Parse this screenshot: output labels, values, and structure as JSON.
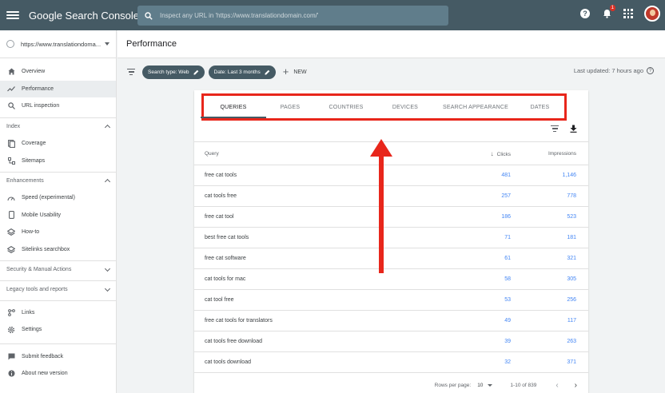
{
  "app": {
    "title": "Google Search Console"
  },
  "search": {
    "placeholder": "Inspect any URL in 'https://www.translationdomain.com/'"
  },
  "header": {
    "notifications_count": "1"
  },
  "property": {
    "label": "https://www.translationdoma..."
  },
  "sidebar": {
    "main_items": [
      {
        "label": "Overview",
        "icon": "home-icon"
      },
      {
        "label": "Performance",
        "icon": "trend-icon",
        "active": true
      },
      {
        "label": "URL inspection",
        "icon": "search-icon"
      }
    ],
    "index_section": "Index",
    "index_items": [
      {
        "label": "Coverage",
        "icon": "coverage-icon"
      },
      {
        "label": "Sitemaps",
        "icon": "sitemap-icon"
      }
    ],
    "enhancements_section": "Enhancements",
    "enhancement_items": [
      {
        "label": "Speed (experimental)",
        "icon": "speed-icon"
      },
      {
        "label": "Mobile Usability",
        "icon": "mobile-icon"
      },
      {
        "label": "How-to",
        "icon": "layers-icon"
      },
      {
        "label": "Sitelinks searchbox",
        "icon": "layers-icon"
      }
    ],
    "security_section": "Security & Manual Actions",
    "legacy_section": "Legacy tools and reports",
    "bottom_items": [
      {
        "label": "Links",
        "icon": "links-icon"
      },
      {
        "label": "Settings",
        "icon": "gear-icon"
      }
    ],
    "footer_items": [
      {
        "label": "Submit feedback",
        "icon": "feedback-icon"
      },
      {
        "label": "About new version",
        "icon": "info-icon"
      }
    ]
  },
  "page": {
    "title": "Performance"
  },
  "filters": {
    "chips": [
      "Search type: Web",
      "Date: Last 3 months"
    ],
    "new_label": "NEW",
    "last_updated": "Last updated: 7 hours ago"
  },
  "tabs": [
    "QUERIES",
    "PAGES",
    "COUNTRIES",
    "DEVICES",
    "SEARCH APPEARANCE",
    "DATES"
  ],
  "table": {
    "headers": {
      "query": "Query",
      "clicks": "Clicks",
      "impressions": "Impressions"
    },
    "rows": [
      {
        "query": "free cat tools",
        "clicks": "481",
        "impressions": "1,146"
      },
      {
        "query": "cat tools free",
        "clicks": "257",
        "impressions": "778"
      },
      {
        "query": "free cat tool",
        "clicks": "186",
        "impressions": "523"
      },
      {
        "query": "best free cat tools",
        "clicks": "71",
        "impressions": "181"
      },
      {
        "query": "free cat software",
        "clicks": "61",
        "impressions": "321"
      },
      {
        "query": "cat tools for mac",
        "clicks": "58",
        "impressions": "305"
      },
      {
        "query": "cat tool free",
        "clicks": "53",
        "impressions": "256"
      },
      {
        "query": "free cat tools for translators",
        "clicks": "49",
        "impressions": "117"
      },
      {
        "query": "cat tools free download",
        "clicks": "39",
        "impressions": "263"
      },
      {
        "query": "cat tools download",
        "clicks": "32",
        "impressions": "371"
      }
    ]
  },
  "pager": {
    "rows_label": "Rows per page:",
    "rows_value": "10",
    "range": "1-10 of 839"
  },
  "colors": {
    "topbar": "#455a64",
    "accent_blue": "#4285f4",
    "annotation_red": "#e8261b"
  }
}
